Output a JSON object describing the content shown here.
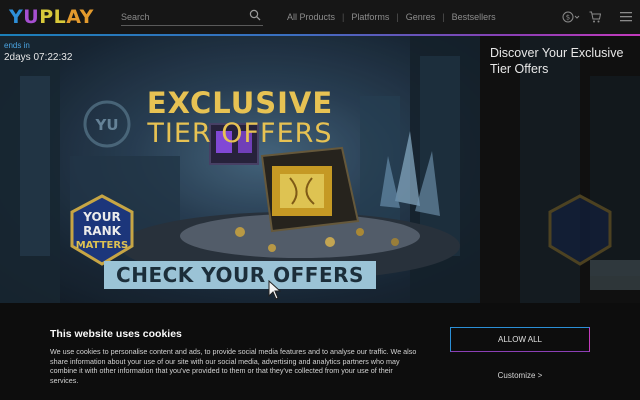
{
  "header": {
    "logo_text": "YUPLAY",
    "search": {
      "placeholder": "Search"
    },
    "nav": [
      "All Products",
      "Platforms",
      "Genres",
      "Bestsellers"
    ],
    "icons": [
      "search-icon",
      "currency-icon",
      "cart-icon",
      "menu-icon"
    ],
    "accent_colors": [
      "#2e8fd8",
      "#a64fd0",
      "#d8c93a",
      "#e39a2d"
    ]
  },
  "hero": {
    "countdown_label": "ends in",
    "countdown_value": "2days 07:22:32",
    "title_line1": "EXCLUSIVE",
    "title_line2": "TIER OFFERS",
    "badge_lines": [
      "YOUR",
      "RANK",
      "MATTERS"
    ],
    "cta": "CHECK YOUR OFFERS",
    "side_title": "Discover Your Exclusive Tier Offers"
  },
  "cookie": {
    "title": "This website uses cookies",
    "text": "We use cookies to personalise content and ads, to provide social media features and to analyse our traffic. We also share information about your use of our site with our social media, advertising and analytics partners who may combine it with other information that you've provided to them or that they've collected from your use of their services.",
    "allow_all": "ALLOW ALL",
    "customize": "Customize >"
  }
}
